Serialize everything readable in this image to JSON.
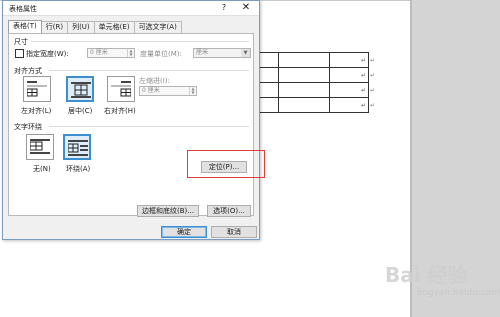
{
  "dialog": {
    "title": "表格属性",
    "help_glyph": "?",
    "close_glyph": "✕",
    "tabs": [
      {
        "label": "表格(T)"
      },
      {
        "label": "行(R)"
      },
      {
        "label": "列(U)"
      },
      {
        "label": "单元格(E)"
      },
      {
        "label": "可选文字(A)"
      }
    ],
    "size_section": {
      "label": "尺寸",
      "preferred_width_label": "指定宽度(W):",
      "preferred_width_value": "0 厘米",
      "measure_in_label": "度量单位(M):",
      "measure_in_value": "厘米"
    },
    "alignment_section": {
      "label": "对齐方式",
      "options": [
        {
          "label": "左对齐(L)"
        },
        {
          "label": "居中(C)"
        },
        {
          "label": "右对齐(H)"
        }
      ],
      "indent_label": "左缩进(I):",
      "indent_value": "0 厘米"
    },
    "wrapping_section": {
      "label": "文字环绕",
      "options": [
        {
          "label": "无(N)"
        },
        {
          "label": "环绕(A)"
        }
      ],
      "positioning_button": "定位(P)..."
    },
    "borders_button": "边框和底纹(B)...",
    "options_button": "选项(O)...",
    "ok_button": "确定",
    "cancel_button": "取消"
  },
  "document": {
    "paragraph_mark": "↵"
  },
  "watermark": {
    "brand": "Bai 经验",
    "domain": "jingyan.baidu.com"
  },
  "colors": {
    "highlight": "#e03a3a",
    "selection_accent": "#3c8fcf"
  }
}
